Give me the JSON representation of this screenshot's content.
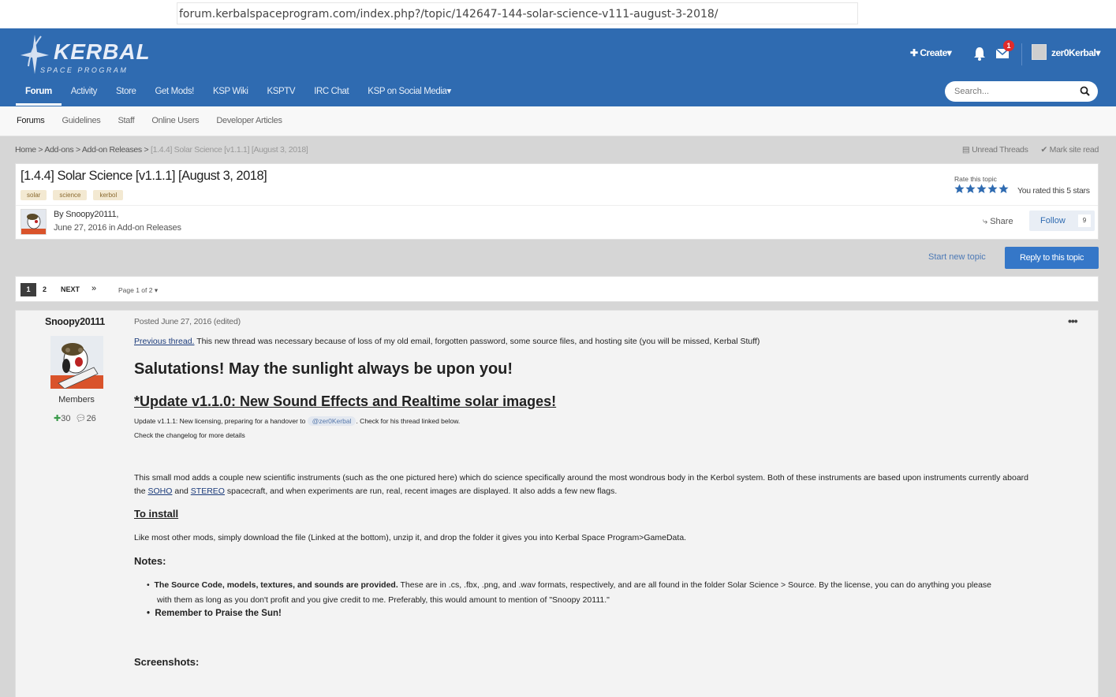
{
  "browser": {
    "url": "forum.kerbalspaceprogram.com/index.php?/topic/142647-144-solar-science-v111-august-3-2018/"
  },
  "header": {
    "logo_text": "KERBAL",
    "logo_sub": "SPACE PROGRAM",
    "create_label": "Create",
    "notifications_badge": "1",
    "username": "zer0Kerbal",
    "nav": [
      "Forum",
      "Activity",
      "Store",
      "Get Mods!",
      "KSP Wiki",
      "KSPTV",
      "IRC Chat",
      "KSP on Social Media"
    ],
    "search_placeholder": "Search..."
  },
  "subnav": [
    "Forums",
    "Guidelines",
    "Staff",
    "Online Users",
    "Developer Articles"
  ],
  "breadcrumb": {
    "items": [
      "Home",
      "Add-ons",
      "Add-on Releases"
    ],
    "current": "[1.4.4] Solar Science [v1.1.1] [August 3, 2018]",
    "unread": "Unread Threads",
    "mark_read": "Mark site read"
  },
  "topic": {
    "title": "[1.4.4] Solar Science [v1.1.1] [August 3, 2018]",
    "tags": [
      "solar",
      "science",
      "kerbol"
    ],
    "author_by": "By Snoopy20111,",
    "author_date": "June 27, 2016 in Add-on Releases",
    "rate_label": "Rate this topic",
    "rated_text": "You rated this 5 stars",
    "rating": 5,
    "share_label": "Share",
    "follow_label": "Follow",
    "follow_count": "9"
  },
  "actions": {
    "start_new": "Start new topic",
    "reply": "Reply to this topic"
  },
  "pager": {
    "current": "1",
    "page2": "2",
    "next": "NEXT",
    "last": "»",
    "page_of": "Page 1 of 2"
  },
  "post": {
    "author": "Snoopy20111",
    "group": "Members",
    "rep": "30",
    "posts": "26",
    "meta": "Posted June 27, 2016 (edited)",
    "more": "•••",
    "previous_link": "Previous thread.",
    "intro_rest": " This new thread was necessary because of loss of my old email, forgotten password, some source files, and hosting site (you will be missed, Kerbal Stuff)",
    "salutation": "Salutations! May the sunlight always be upon you!",
    "update_heading": "*Update v1.1.0: New Sound Effects and Realtime solar images!",
    "update_line_pre": "Update v1.1.1: New licensing, preparing for a handover to ",
    "update_mention": "@zer0Kerbal",
    "update_line_post": ". Check for his thread linked below.",
    "changelog_line": "Check the changelog for more details",
    "desc_line1": "This small mod adds a couple new scientific instruments (such as the one pictured here) which do science specifically around the most wondrous body in the Kerbol system. Both of these instruments are based upon instruments currently aboard",
    "desc_line2_pre": "the ",
    "soho": "SOHO",
    "desc_and": " and ",
    "stereo": "STEREO",
    "desc_line2_post": " spacecraft, and when experiments are run, real, recent images are displayed. It also adds a few new flags.",
    "install_heading": "To install",
    "install_text": "Like most other mods, simply download the file (Linked at the bottom), unzip it, and drop the folder it gives you into Kerbal Space Program>GameData.",
    "notes_heading": "Notes:",
    "note1_bold": "The Source Code, models, textures, and sounds are provided.",
    "note1_rest": " These are in .cs, .fbx, .png, and .wav formats, respectively, and are all found in the folder Solar Science > Source. By the license, you can do anything you please",
    "note1_cont": "with them as long as you don't profit and you give credit to me. Preferably, this would amount to mention of \"Snoopy 20111.\"",
    "note2_bold": "Remember to Praise the Sun!",
    "screenshots_heading": "Screenshots:"
  },
  "colors": {
    "header_blue": "#2f6bb1",
    "reply_button": "#3577c8",
    "badge_red": "#e02b2b",
    "star_blue": "#2f6bb1"
  }
}
